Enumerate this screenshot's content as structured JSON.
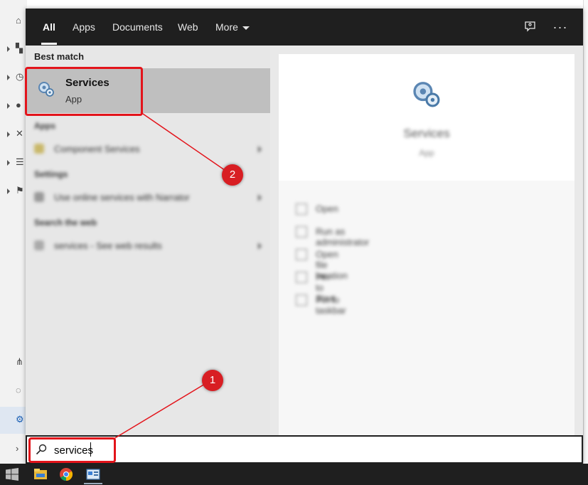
{
  "tabs": [
    {
      "label": "All",
      "active": true
    },
    {
      "label": "Apps"
    },
    {
      "label": "Documents"
    },
    {
      "label": "Web"
    },
    {
      "label": "More"
    }
  ],
  "topbar_icons": [
    "feedback-icon",
    "more-options-icon"
  ],
  "best_match": {
    "section_label": "Best match",
    "name": "Services",
    "type": "App",
    "icon": "services-gear-icon"
  },
  "blurred_results": {
    "apps_header": "Apps",
    "apps_item": "Component Services",
    "settings_header": "Settings",
    "settings_item": "Use online services with Narrator",
    "web_header": "Search the web",
    "web_item": "services - See web results"
  },
  "preview": {
    "name": "Services",
    "type": "App",
    "actions": [
      "Open",
      "Run as administrator",
      "Open file location",
      "Pin to Start",
      "Pin to taskbar"
    ]
  },
  "search": {
    "value": "services"
  },
  "annotations": {
    "step1": "1",
    "step2": "2",
    "color": "#e3141b"
  },
  "taskbar_icons": [
    "windows-start-icon",
    "file-explorer-icon",
    "chrome-icon",
    "control-panel-icon"
  ]
}
